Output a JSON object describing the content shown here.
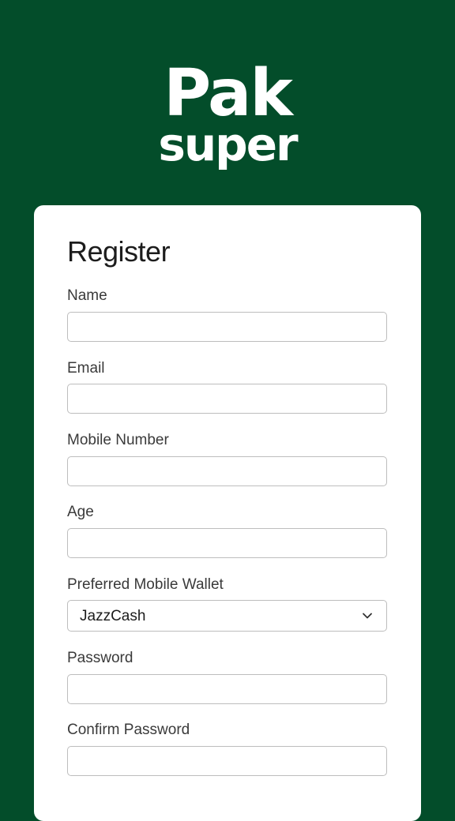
{
  "logo": {
    "line1": "Pak",
    "line2": "super",
    "star": "★"
  },
  "form": {
    "title": "Register",
    "fields": [
      {
        "label": "Name",
        "value": ""
      },
      {
        "label": "Email",
        "value": ""
      },
      {
        "label": "Mobile Number",
        "value": ""
      },
      {
        "label": "Age",
        "value": ""
      }
    ],
    "wallet": {
      "label": "Preferred Mobile Wallet",
      "selected": "JazzCash",
      "icon": "chevron-down-icon"
    },
    "password": {
      "label": "Password",
      "value": ""
    },
    "confirm_password": {
      "label": "Confirm Password",
      "value": ""
    }
  },
  "colors": {
    "background": "#034d2a",
    "card": "#ffffff",
    "border": "#bdbdbd",
    "text": "#1c1c1c"
  }
}
